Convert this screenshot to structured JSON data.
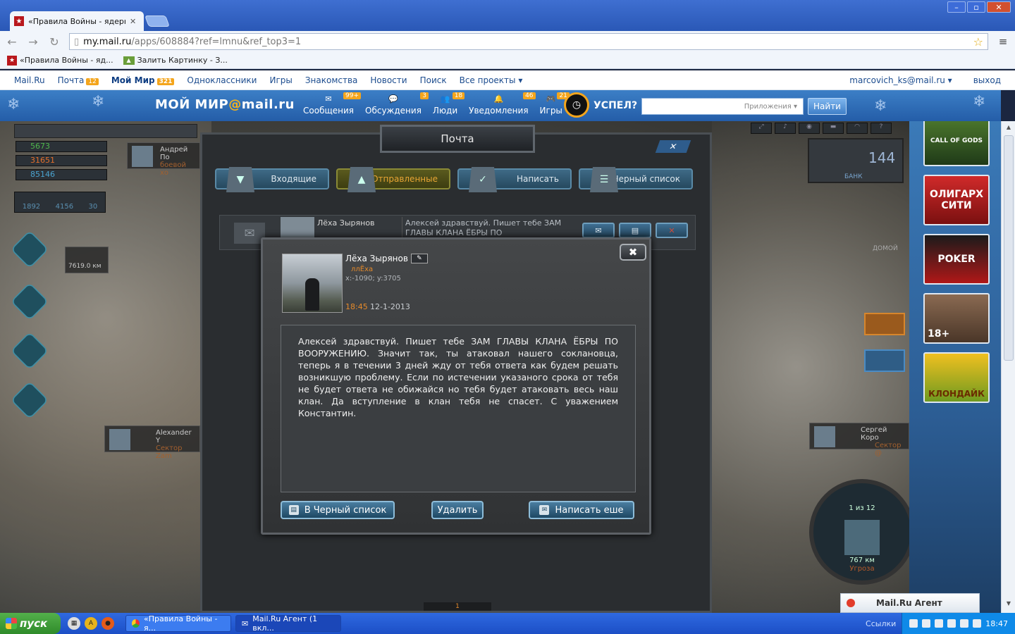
{
  "browser": {
    "tab_title": "«Правила Войны - ядерная",
    "tab_favicon": "star-favicon",
    "url_host": "my.mail.ru",
    "url_path": "/apps/608884?ref=lmnu&ref_top3=1"
  },
  "bookmarks": [
    {
      "label": "«Правила Войны - яд..."
    },
    {
      "label": "Залить Картинку - З..."
    }
  ],
  "mailnav": {
    "items": [
      {
        "label": "Mail.Ru"
      },
      {
        "label": "Почта",
        "count": "12"
      },
      {
        "label": "Мой Мир",
        "count": "321"
      },
      {
        "label": "Одноклассники"
      },
      {
        "label": "Игры"
      },
      {
        "label": "Знакомства"
      },
      {
        "label": "Новости"
      },
      {
        "label": "Поиск"
      },
      {
        "label": "Все проекты ▾"
      }
    ],
    "user": "marcovich_ks@mail.ru ▾",
    "logout": "выход"
  },
  "mirbar": {
    "logo_a": "МОЙ МИР",
    "logo_b": "@",
    "logo_c": "mail.ru",
    "nav": [
      {
        "label": "Сообщения",
        "badge": "99+"
      },
      {
        "label": "Обсуждения",
        "badge": "3"
      },
      {
        "label": "Люди",
        "badge": "18"
      },
      {
        "label": "Уведомления",
        "badge": "46"
      },
      {
        "label": "Игры",
        "badge": "21"
      }
    ],
    "uspel": "УСПЕЛ?",
    "search_placeholder": "Приложения ▾",
    "find": "Найти"
  },
  "game": {
    "resources": [
      "5673",
      "31651",
      "85146"
    ],
    "stats": [
      "1892",
      "4156",
      "30"
    ],
    "players": [
      {
        "name": "Андрей По",
        "sub": "боевой хо"
      },
      {
        "name": "7619.0 км",
        "sub": ""
      },
      {
        "name": "Alexander Y",
        "sub": "Сектор Zam"
      },
      {
        "name": "Сергей Коро",
        "sub": "Сектор @"
      }
    ],
    "bank_value": "144",
    "bank_label": "БАНК",
    "home_label": "ДОМОЙ",
    "radar_count": "1 из 12",
    "radar_dist": "767 км",
    "radar_threat": "Угроза",
    "page_value": "1"
  },
  "mail": {
    "title": "Почта",
    "tabs": [
      {
        "label": "Входящие"
      },
      {
        "label": "Отправленные"
      },
      {
        "label": "Написать"
      },
      {
        "label": "Черный список"
      }
    ],
    "row": {
      "name": "Лёха Зырянов",
      "preview": "Алексей здравствуй. Пишет тебе ЗАМ ГЛАВЫ КЛАНА ЁБРЫ ПО"
    }
  },
  "dialog": {
    "sender": "Лёха Зырянов",
    "nick": "ллЁха",
    "coords": "x:-1090; y:3705",
    "time": "18:45",
    "date": "12-1-2013",
    "body": "Алексей здравствуй. Пишет тебе ЗАМ ГЛАВЫ КЛАНА ЁБРЫ ПО ВООРУЖЕНИЮ. Значит так, ты атаковал нашего сокланoвца, теперь я в течении 3 дней жду от тебя ответа как будем решать возникшую проблему. Если по истечении указаного срока от тебя не будет ответа не обижайся но тебя будет атаковать весь наш клан. Да вступление в клан тебя не спасет. С уважением Константин.",
    "btn_blacklist": "В Черный список",
    "btn_delete": "Удалить",
    "btn_write": "Написать еше"
  },
  "ads": [
    {
      "label": "CALL OF GODS"
    },
    {
      "label": "ОЛИГАРХ СИТИ"
    },
    {
      "label": "POKER"
    },
    {
      "label": "18+"
    },
    {
      "label": "КЛОНДАЙК"
    }
  ],
  "agent": {
    "label": "Mail.Ru Агент"
  },
  "taskbar": {
    "start": "пуск",
    "tasks": [
      {
        "label": "«Правила Войны - я..."
      },
      {
        "label": "Mail.Ru Агент (1 вкл..."
      }
    ],
    "links": "Ссылки",
    "clock": "18:47"
  }
}
